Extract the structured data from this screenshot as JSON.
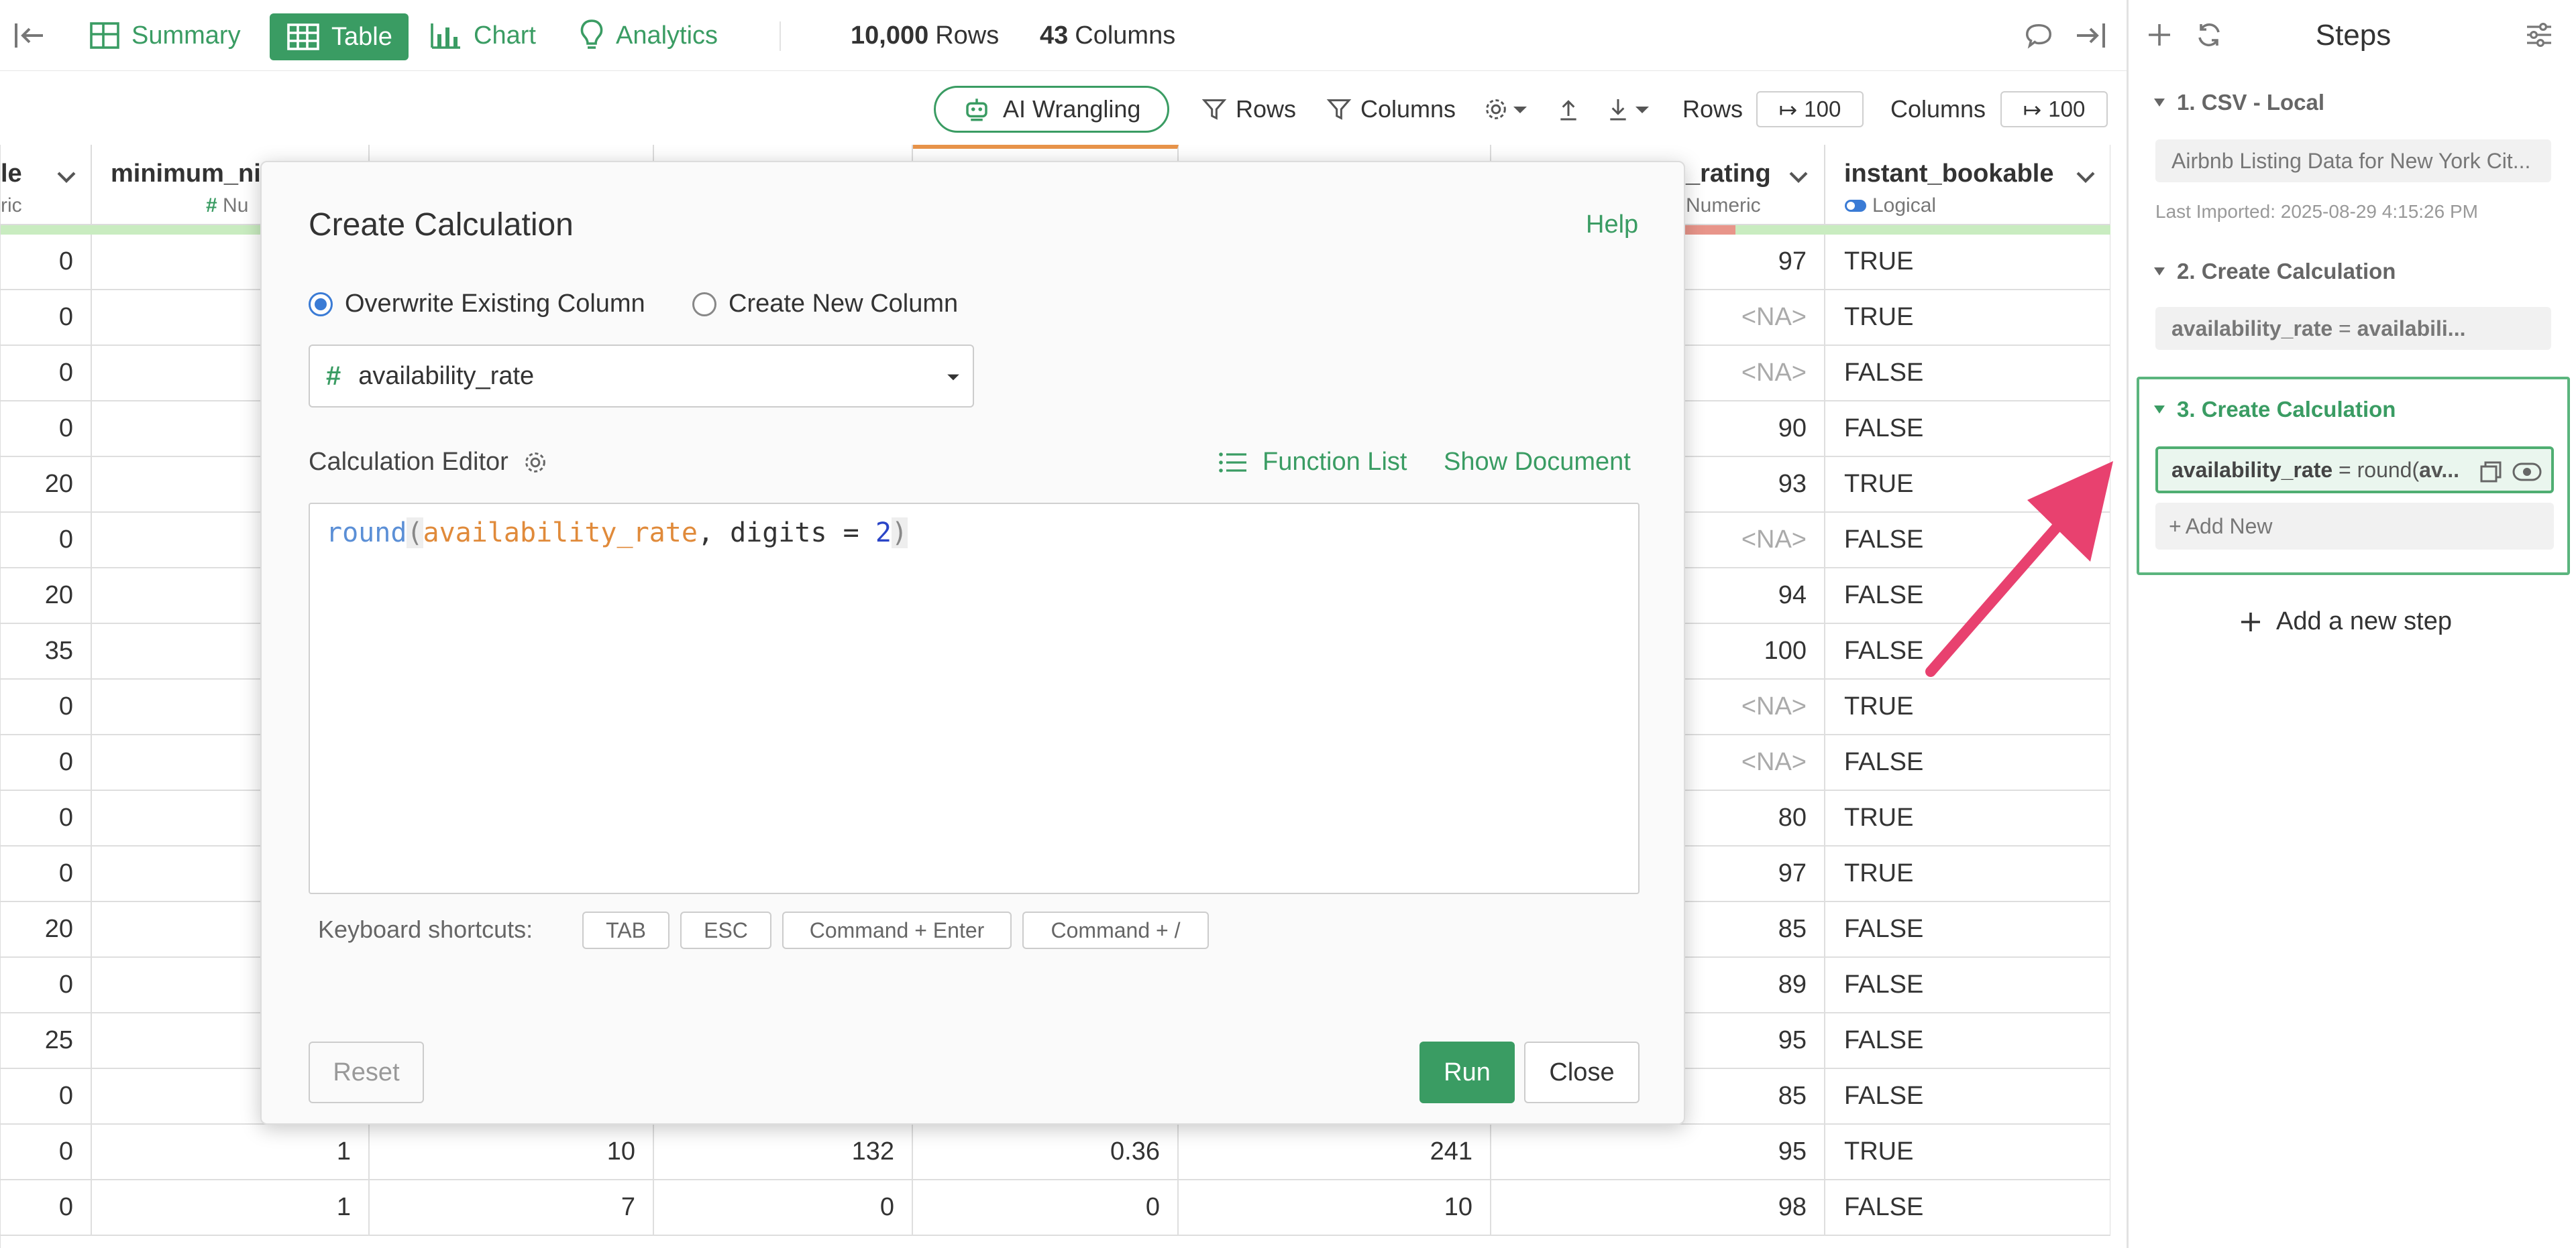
{
  "topbar": {
    "tabs": [
      {
        "label": "Summary",
        "icon": "summary-grid-icon"
      },
      {
        "label": "Table",
        "icon": "table-icon",
        "active": true
      },
      {
        "label": "Chart",
        "icon": "bar-chart-icon"
      },
      {
        "label": "Analytics",
        "icon": "lightbulb-icon"
      }
    ],
    "rows_count": "10,000",
    "rows_label": "Rows",
    "cols_count": "43",
    "cols_label": "Columns"
  },
  "toolbar": {
    "ai_wrangling": "AI Wrangling",
    "rows_filter": "Rows",
    "columns_filter": "Columns",
    "rows_label": "Rows",
    "rows_value": "100",
    "columns_label": "Columns",
    "columns_value": "100"
  },
  "table": {
    "headers": [
      {
        "name": "le",
        "type": "ric"
      },
      {
        "name": "minimum_ni",
        "type": "Nu"
      },
      {
        "name": "",
        "type": ""
      },
      {
        "name": "",
        "type": ""
      },
      {
        "name": "",
        "type": ""
      },
      {
        "name": "",
        "type": ""
      },
      {
        "name": "_rating",
        "type": "Numeric"
      },
      {
        "name": "instant_bookable",
        "type": "Logical"
      }
    ],
    "col1": [
      "0",
      "0",
      "0",
      "0",
      "20",
      "0",
      "20",
      "35",
      "0",
      "0",
      "0",
      "0",
      "20",
      "0",
      "25",
      "0",
      "0",
      "0"
    ],
    "rating": [
      "97",
      "<NA>",
      "<NA>",
      "90",
      "93",
      "<NA>",
      "94",
      "100",
      "<NA>",
      "<NA>",
      "80",
      "97",
      "85",
      "89",
      "95",
      "85",
      "95",
      "98"
    ],
    "bookable": [
      "TRUE",
      "TRUE",
      "FALSE",
      "FALSE",
      "TRUE",
      "FALSE",
      "FALSE",
      "FALSE",
      "TRUE",
      "FALSE",
      "TRUE",
      "TRUE",
      "FALSE",
      "FALSE",
      "FALSE",
      "FALSE",
      "TRUE",
      "FALSE"
    ],
    "bottom_rows": [
      {
        "c2": "1",
        "c3": "10",
        "c4": "132",
        "c5": "0.36",
        "c6": "241"
      },
      {
        "c2": "1",
        "c3": "7",
        "c4": "0",
        "c5": "0",
        "c6": "10"
      }
    ]
  },
  "modal": {
    "title": "Create Calculation",
    "help": "Help",
    "radio_overwrite": "Overwrite Existing Column",
    "radio_new": "Create New Column",
    "column_select": "availability_rate",
    "editor_label": "Calculation Editor",
    "function_list": "Function List",
    "show_document": "Show Document",
    "code": {
      "fn": "round",
      "open": "(",
      "col": "availability_rate",
      "mid": ", digits = ",
      "num": "2",
      "close": ")"
    },
    "shortcuts_label": "Keyboard shortcuts:",
    "shortcuts": [
      "TAB",
      "ESC",
      "Command + Enter",
      "Command + /"
    ],
    "reset": "Reset",
    "run": "Run",
    "close": "Close"
  },
  "sidebar": {
    "title": "Steps",
    "step1_title": "1. CSV - Local",
    "step1_item": "Airbnb Listing Data for New York Cit...",
    "step1_imported": "Last Imported: 2025-08-29 4:15:26 PM",
    "step2_title": "2. Create Calculation",
    "step2_item_col": "availability_rate",
    "step2_item_eq": " = ",
    "step2_item_expr": "availabili...",
    "step3_title": "3. Create Calculation",
    "step3_item_col": "availability_rate",
    "step3_item_eq": " = round(",
    "step3_item_expr": "av...",
    "add_new": "Add New",
    "add_step": "Add a new step"
  },
  "colors": {
    "accent": "#3a9c63",
    "arrow": "#e8416f",
    "code_function": "#5b8fd6",
    "code_column": "#e08a3a",
    "code_number": "#2b45c7"
  }
}
